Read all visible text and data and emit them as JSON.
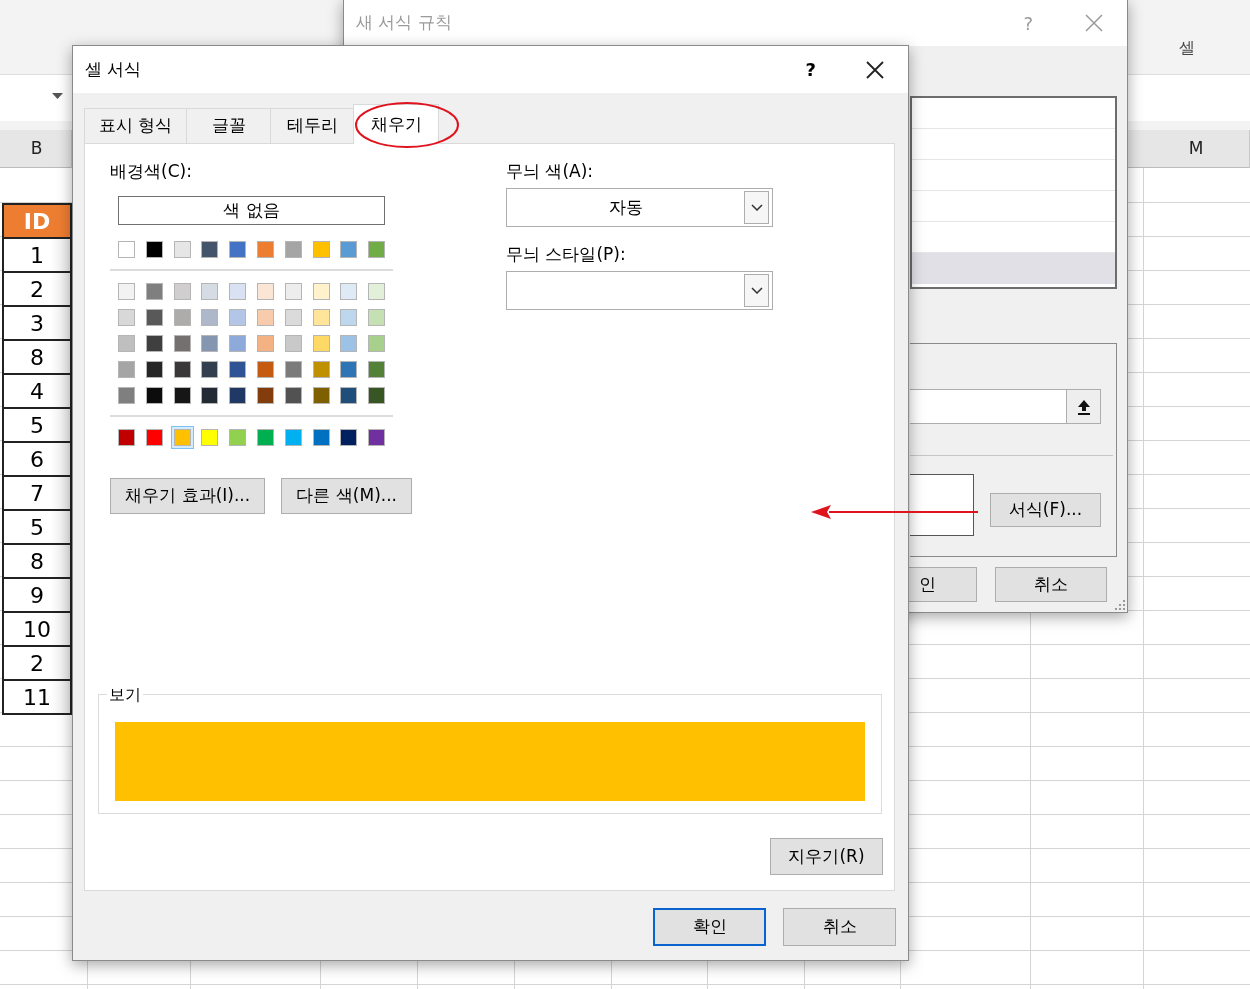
{
  "ribbon": {
    "group_label": "셀"
  },
  "sheet": {
    "column_headers": [
      {
        "text": "B"
      },
      {
        "text": "M"
      }
    ],
    "column_b": [
      {
        "text": "ID",
        "kind": "header"
      },
      {
        "text": "1",
        "kind": "value"
      },
      {
        "text": "2",
        "kind": "value"
      },
      {
        "text": "3",
        "kind": "value"
      },
      {
        "text": "8",
        "kind": "value"
      },
      {
        "text": "4",
        "kind": "value"
      },
      {
        "text": "5",
        "kind": "value"
      },
      {
        "text": "6",
        "kind": "value"
      },
      {
        "text": "7",
        "kind": "value"
      },
      {
        "text": "5",
        "kind": "value"
      },
      {
        "text": "8",
        "kind": "value"
      },
      {
        "text": "9",
        "kind": "value"
      },
      {
        "text": "10",
        "kind": "value"
      },
      {
        "text": "2",
        "kind": "value"
      },
      {
        "text": "11",
        "kind": "value"
      }
    ]
  },
  "back_dialog": {
    "title": "새 서식 규칙",
    "help": "?",
    "list_rows": [
      {
        "selected": false
      },
      {
        "selected": false
      },
      {
        "selected": false
      },
      {
        "selected": false
      },
      {
        "selected": false
      },
      {
        "selected": true
      }
    ],
    "format_button": "서식(F)...",
    "ok_button": "인",
    "cancel_button": "취소"
  },
  "main_dialog": {
    "title": "셀 서식",
    "help": "?",
    "tabs": [
      {
        "label": "표시 형식",
        "selected": false
      },
      {
        "label": "글꼴",
        "selected": false
      },
      {
        "label": "테두리",
        "selected": false
      },
      {
        "label": "채우기",
        "selected": true
      }
    ],
    "background_label": "배경색(C):",
    "no_color_button": "색 없음",
    "theme_colors": [
      {
        "color": "#ffffff",
        "selected": false
      },
      {
        "color": "#000000",
        "selected": false
      },
      {
        "color": "#e7e6e6",
        "selected": false
      },
      {
        "color": "#44546a",
        "selected": false
      },
      {
        "color": "#4472c4",
        "selected": false
      },
      {
        "color": "#ed7d31",
        "selected": false
      },
      {
        "color": "#a5a5a5",
        "selected": false
      },
      {
        "color": "#ffc000",
        "selected": false
      },
      {
        "color": "#5b9bd5",
        "selected": false
      },
      {
        "color": "#70ad47",
        "selected": false
      }
    ],
    "shades": [
      {
        "color": "#f2f2f2",
        "selected": false
      },
      {
        "color": "#7f7f7f",
        "selected": false
      },
      {
        "color": "#d0cece",
        "selected": false
      },
      {
        "color": "#d6dce4",
        "selected": false
      },
      {
        "color": "#d9e2f3",
        "selected": false
      },
      {
        "color": "#fbe5d5",
        "selected": false
      },
      {
        "color": "#ededed",
        "selected": false
      },
      {
        "color": "#fff2cc",
        "selected": false
      },
      {
        "color": "#deebf6",
        "selected": false
      },
      {
        "color": "#e2efd9",
        "selected": false
      },
      {
        "color": "#d8d8d8",
        "selected": false
      },
      {
        "color": "#595959",
        "selected": false
      },
      {
        "color": "#aeabab",
        "selected": false
      },
      {
        "color": "#adb9ca",
        "selected": false
      },
      {
        "color": "#b4c6e7",
        "selected": false
      },
      {
        "color": "#f7cbac",
        "selected": false
      },
      {
        "color": "#dbdbdb",
        "selected": false
      },
      {
        "color": "#fee599",
        "selected": false
      },
      {
        "color": "#bdd7ee",
        "selected": false
      },
      {
        "color": "#c5e0b3",
        "selected": false
      },
      {
        "color": "#bfbfbf",
        "selected": false
      },
      {
        "color": "#3f3f3f",
        "selected": false
      },
      {
        "color": "#757070",
        "selected": false
      },
      {
        "color": "#8496b0",
        "selected": false
      },
      {
        "color": "#8eaadb",
        "selected": false
      },
      {
        "color": "#f4b183",
        "selected": false
      },
      {
        "color": "#c9c9c9",
        "selected": false
      },
      {
        "color": "#ffd965",
        "selected": false
      },
      {
        "color": "#9cc3e5",
        "selected": false
      },
      {
        "color": "#a8d08d",
        "selected": false
      },
      {
        "color": "#a5a5a5",
        "selected": false
      },
      {
        "color": "#262626",
        "selected": false
      },
      {
        "color": "#3a3838",
        "selected": false
      },
      {
        "color": "#323f4f",
        "selected": false
      },
      {
        "color": "#2f5496",
        "selected": false
      },
      {
        "color": "#c55a11",
        "selected": false
      },
      {
        "color": "#7b7b7b",
        "selected": false
      },
      {
        "color": "#bf9000",
        "selected": false
      },
      {
        "color": "#2e75b5",
        "selected": false
      },
      {
        "color": "#538135",
        "selected": false
      },
      {
        "color": "#7f7f7f",
        "selected": false
      },
      {
        "color": "#0c0c0c",
        "selected": false
      },
      {
        "color": "#171616",
        "selected": false
      },
      {
        "color": "#222a35",
        "selected": false
      },
      {
        "color": "#1f3864",
        "selected": false
      },
      {
        "color": "#833c0b",
        "selected": false
      },
      {
        "color": "#525252",
        "selected": false
      },
      {
        "color": "#7f6000",
        "selected": false
      },
      {
        "color": "#1e4e79",
        "selected": false
      },
      {
        "color": "#375623",
        "selected": false
      }
    ],
    "standard_colors": [
      {
        "color": "#c00000",
        "selected": false
      },
      {
        "color": "#ff0000",
        "selected": false
      },
      {
        "color": "#ffc000",
        "selected": true
      },
      {
        "color": "#ffff00",
        "selected": false
      },
      {
        "color": "#92d050",
        "selected": false
      },
      {
        "color": "#00b050",
        "selected": false
      },
      {
        "color": "#00b0f0",
        "selected": false
      },
      {
        "color": "#0070c0",
        "selected": false
      },
      {
        "color": "#002060",
        "selected": false
      },
      {
        "color": "#7030a0",
        "selected": false
      }
    ],
    "fill_effects_button": "채우기 효과(I)...",
    "more_colors_button": "다른 색(M)...",
    "pattern_color_label": "무늬 색(A):",
    "pattern_color": {
      "value": "자동"
    },
    "pattern_style_label": "무늬 스타일(P):",
    "sample_label": "보기",
    "clear_button": "지우기(R)",
    "ok_button": "확인",
    "cancel_button": "취소"
  }
}
